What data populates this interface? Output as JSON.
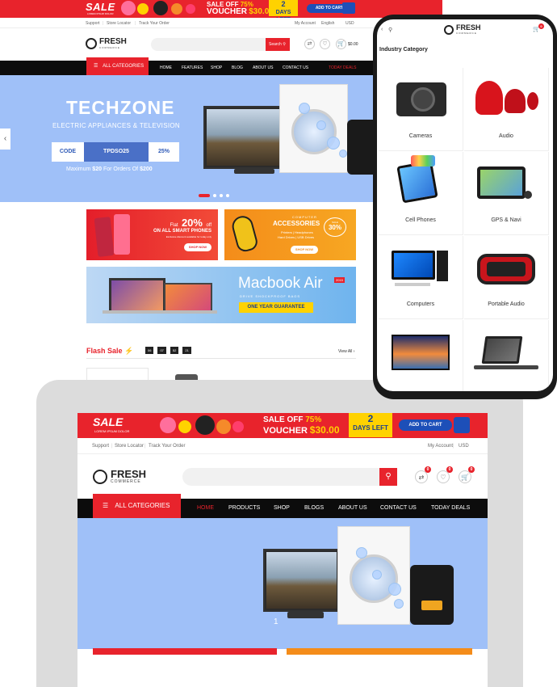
{
  "promo": {
    "sale": "SALE",
    "sale_sub": "LOREM IPSUM DOLOR",
    "off_line1": "SALE OFF",
    "off_pct": "75%",
    "voucher_label": "VOUCHER",
    "voucher_amount": "$30.00",
    "days_num": "2",
    "days_label": "DAYS LEFT",
    "cart_button": "ADD TO CART"
  },
  "desktop": {
    "topbar": {
      "support": "Support",
      "store": "Store Locator",
      "track": "Track Your Order",
      "account": "My Account",
      "language": "English",
      "currency": "USD"
    },
    "logo": {
      "name": "FRESH",
      "tag": "COMMERCE"
    },
    "search_button": "Search",
    "cart_total": "$0.00",
    "nav": {
      "all_categories": "ALL CATEGORIES",
      "items": [
        "HOME",
        "FEATURES",
        "SHOP",
        "BLOG",
        "ABOUT US",
        "CONTACT US",
        "TODAY DEALS"
      ]
    },
    "hero": {
      "title": "TECHZONE",
      "subtitle": "ELECTRIC APPLIANCES & TELEVISION",
      "code_label": "CODE",
      "code_value": "TPDSO25",
      "discount": "25%",
      "max_prefix": "Maximum",
      "max_value": "$20",
      "max_mid": "For Orders Of",
      "max_order": "$200"
    },
    "banner1": {
      "flat": "Flat",
      "pct": "20%",
      "off": "off",
      "line": "ON ALL SMART PHONES",
      "small": "Exclusive discount available for today only",
      "button": "SHOP NOW"
    },
    "banner2": {
      "kicker": "COMPUTER",
      "title": "ACCESSORIES",
      "list": "Printers | Headphones",
      "list2": "Hard Drives | USB Drives",
      "sale": "SALE",
      "pct": "30%",
      "button": "SHOP NOW"
    },
    "banner3": {
      "title": "Macbook Air",
      "year": "2015",
      "sub": "DRIVE SHOCKPROOF BAGS",
      "guarantee": "ONE YEAR GUARANTEE"
    },
    "flash": {
      "title": "Flash Sale",
      "timer": [
        "06",
        "07",
        "52",
        "21"
      ],
      "view_all": "View All"
    }
  },
  "tablet": {
    "topbar": {
      "support": "Support",
      "store": "Store Locator",
      "track": "Track Your Order",
      "account": "My Account",
      "currency": "USD"
    },
    "badges": [
      "0",
      "0",
      "0"
    ],
    "nav": {
      "all_categories": "ALL CATEGORIES",
      "items": [
        "HOME",
        "PRODUCTS",
        "SHOP",
        "BLOGS",
        "ABOUT US",
        "CONTACT US",
        "TODAY DEALS"
      ]
    },
    "slide_number": "1"
  },
  "phone": {
    "badge": "0",
    "section_title": "Industry Category",
    "categories": [
      "Cameras",
      "Audio",
      "Cell Phones",
      "GPS & Navi",
      "Computers",
      "Portable Audio",
      "",
      ""
    ]
  },
  "colors": {
    "brand_red": "#e8232c",
    "nav_black": "#0c0c0c",
    "hero_blue": "#9fc0f8",
    "promo_yellow": "#ffd200",
    "cart_blue": "#1d4fb8"
  }
}
